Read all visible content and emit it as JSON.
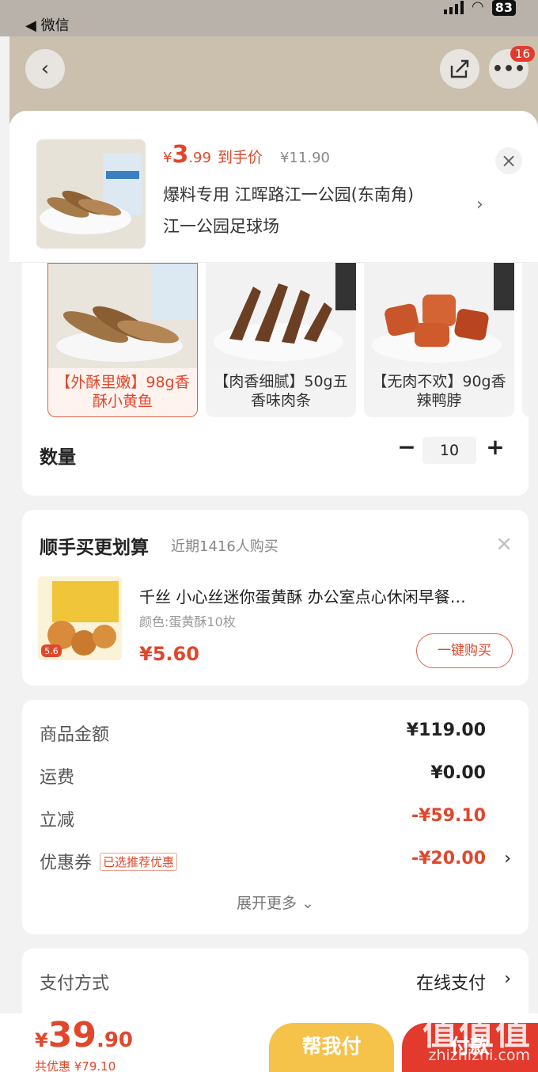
{
  "status_bar": {
    "back_app": "◀ 微信",
    "battery": "83"
  },
  "header": {
    "notification_count": "16"
  },
  "product": {
    "price_symbol": "¥",
    "price_int": "3",
    "price_dec": ".99",
    "price_tag": "到手价",
    "original_price": "¥11.90",
    "address_line1": "爆料专用  江晖路江一公园(东南角)",
    "address_line2": "江一公园足球场"
  },
  "variants": [
    {
      "label": "【外酥里嫩】98g香酥小黄鱼",
      "selected": true
    },
    {
      "label": "【肉香细腻】50g五香味肉条",
      "selected": false
    },
    {
      "label": "【无肉不欢】90g香辣鸭脖",
      "selected": false
    }
  ],
  "quantity": {
    "label": "数量",
    "value": "10",
    "minus": "−",
    "plus": "+"
  },
  "upsell": {
    "title": "顺手买更划算",
    "subtitle": "近期1416人购买",
    "product_name": "千丝 小心丝迷你蛋黄酥 办公室点心休闲早餐…",
    "spec": "颜色:蛋黄酥10枚",
    "price": "¥5.60",
    "buy_label": "一键购买",
    "img_badge": "5.6"
  },
  "summary": {
    "rows": [
      {
        "key": "商品金额",
        "value": "¥119.00"
      },
      {
        "key": "运费",
        "value": "¥0.00"
      },
      {
        "key": "立减",
        "value": "-¥59.10"
      },
      {
        "key": "优惠券",
        "value": "-¥20.00",
        "tag": "已选推荐优惠"
      }
    ],
    "expand_label": "展开更多 ⌄"
  },
  "payment": {
    "label": "支付方式",
    "value": "在线支付"
  },
  "bottom": {
    "total_symbol": "¥",
    "total_int": "39",
    "total_dec": ".90",
    "total_discount": "共优惠 ¥79.10",
    "help_label": "帮我付",
    "pay_label": "付款"
  },
  "watermark": {
    "main": "值值值",
    "sub": "zhizhizhi.com"
  },
  "colors": {
    "accent_red": "#e0472b",
    "yellow": "#f5c24a"
  }
}
